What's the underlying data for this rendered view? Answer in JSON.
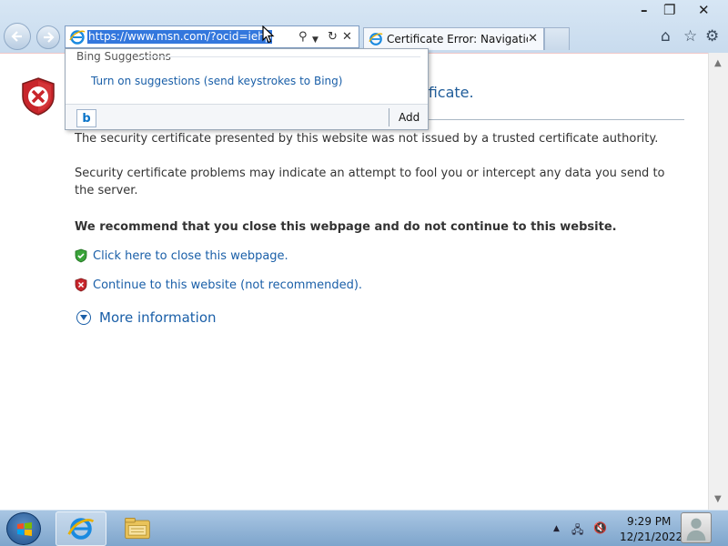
{
  "browser": {
    "address": "https://www.msn.com/?ocid=iehp",
    "tab_title": "Certificate Error: Navigation...",
    "search_glyph": "search-icon",
    "refresh_glyph": "refresh-icon",
    "stop_glyph": "stop-icon"
  },
  "suggestions": {
    "title": "Bing Suggestions",
    "link": "Turn on suggestions (send keystrokes to Bing)",
    "add_label": "Add",
    "bing_label": "b"
  },
  "page": {
    "heading_visible": "tificate.",
    "p1": "The security certificate presented by this website was not issued by a trusted certificate authority.",
    "p2": "Security certificate problems may indicate an attempt to fool you or intercept any data you send to the server.",
    "p3": "We recommend that you close this webpage and do not continue to this website.",
    "close_link": "Click here to close this webpage.",
    "continue_link": "Continue to this website (not recommended).",
    "more_info": "More information"
  },
  "window": {
    "minimize": "–",
    "restore": "❐",
    "close": "✕",
    "home": "⌂",
    "favorites": "☆",
    "tools": "⚙"
  },
  "taskbar": {
    "time": "9:29 PM",
    "date": "12/21/2022",
    "tray_up": "▲"
  },
  "colors": {
    "link": "#1a5fa8",
    "heading": "#1f5c99",
    "selection": "#3377dd"
  }
}
